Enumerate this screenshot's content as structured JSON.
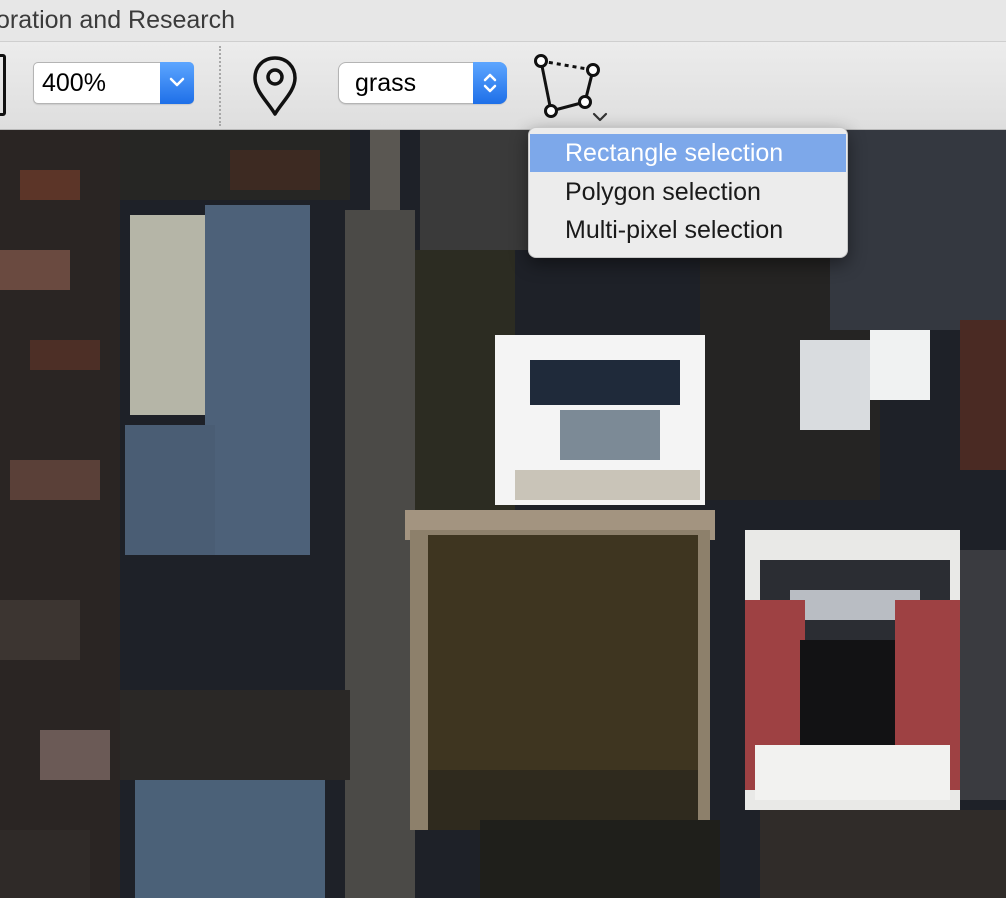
{
  "window": {
    "title": "oration and Research"
  },
  "toolbar": {
    "zoom": {
      "value": "400%"
    },
    "class_select": {
      "value": "grass"
    },
    "icons": [
      "marker-pin-icon",
      "polygon-selection-icon",
      "chevron-down-icon"
    ]
  },
  "selection_menu": {
    "items": [
      "Rectangle selection",
      "Polygon selection",
      "Multi-pixel selection"
    ],
    "selected": "Rectangle selection"
  },
  "colors": {
    "accent": "#1e6fe8",
    "menu_highlight": "#7da8ea"
  }
}
